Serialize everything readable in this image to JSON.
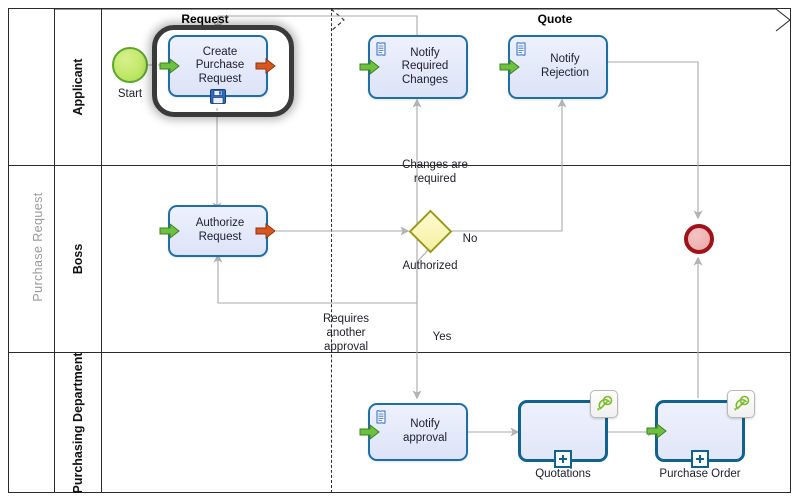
{
  "diagram": {
    "type": "bpmn-process",
    "pool": {
      "label": "Purchase Request"
    },
    "lanes": [
      {
        "id": "applicant",
        "label": "Applicant"
      },
      {
        "id": "boss",
        "label": "Boss"
      },
      {
        "id": "purchasing",
        "label": "Purchasing\nDepartment"
      }
    ],
    "phases": [
      {
        "id": "request",
        "label": "Request"
      },
      {
        "id": "quote",
        "label": "Quote"
      }
    ],
    "nodes": {
      "start": {
        "label": "Start",
        "kind": "start-event"
      },
      "create_purchase_request": {
        "label": "Create\nPurchase\nRequest",
        "kind": "task",
        "selected": true
      },
      "notify_required_changes": {
        "label": "Notify\nRequired\nChanges",
        "kind": "script-task"
      },
      "notify_rejection": {
        "label": "Notify\nRejection",
        "kind": "script-task"
      },
      "authorize_request": {
        "label": "Authorize\nRequest",
        "kind": "task"
      },
      "authorized_gateway": {
        "label": "Authorized",
        "kind": "exclusive-gateway"
      },
      "end": {
        "label": "",
        "kind": "end-event"
      },
      "notify_approval": {
        "label": "Notify\napproval",
        "kind": "script-task"
      },
      "quotations": {
        "label": "Quotations",
        "kind": "subprocess"
      },
      "purchase_order": {
        "label": "Purchase Order",
        "kind": "subprocess"
      }
    },
    "flow_labels": {
      "changes_required": "Changes are\nrequired",
      "no": "No",
      "yes": "Yes",
      "requires_another_approval": "Requires\nanother\napproval"
    },
    "colors": {
      "task_border": "#1f6ea8",
      "task_fill": "#e6ebfa",
      "subprocess_border": "#11638f",
      "start_fill": "#c2e86a",
      "start_border": "#5aa62e",
      "end_fill": "#efb2b2",
      "end_border": "#9d1319",
      "gateway_fill": "#f9f5b4",
      "gateway_border": "#9a9a1c",
      "connector": "#a8a8a8",
      "pool_label": "#9a9a9a",
      "frame": "#2b2b2b",
      "selection_ring": "#3a3a3a",
      "arrow_in": "#6cc23f",
      "arrow_out": "#d9561f"
    }
  }
}
